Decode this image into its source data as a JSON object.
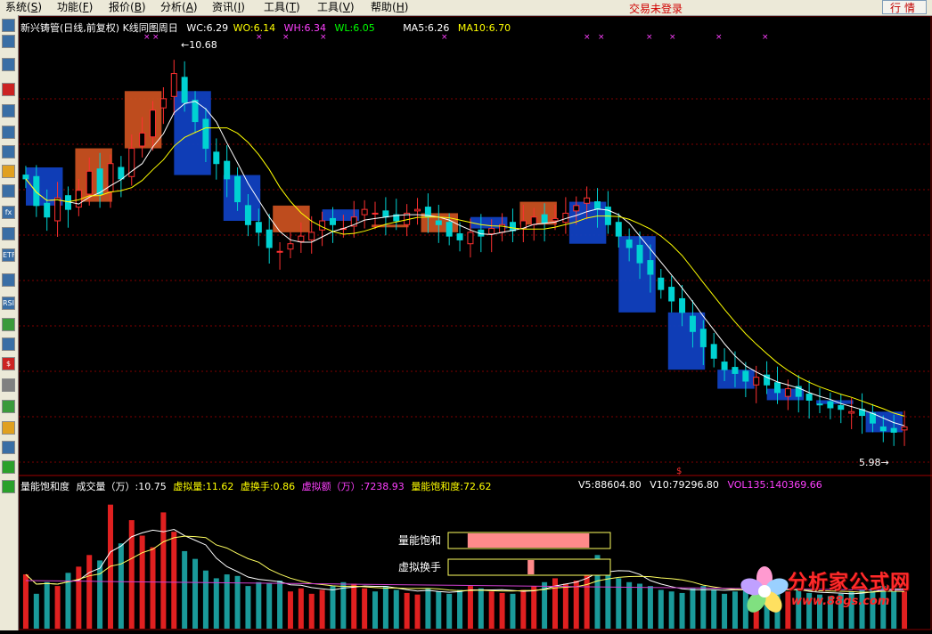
{
  "menu": {
    "items": [
      {
        "label": "系统",
        "key": "S"
      },
      {
        "label": "功能",
        "key": "F"
      },
      {
        "label": "报价",
        "key": "B"
      },
      {
        "label": "分析",
        "key": "A"
      },
      {
        "label": "资讯",
        "key": "I"
      },
      {
        "label": "工具",
        "key": "T"
      },
      {
        "label": "工具",
        "key": "V"
      },
      {
        "label": "帮助",
        "key": "H"
      }
    ],
    "trade_status": "交易未登录",
    "quote_button": "行情"
  },
  "sidebar": {
    "tools": [
      {
        "icon": "list-icon",
        "label": "",
        "color": "#3a6ea5"
      },
      {
        "icon": "split-window-icon",
        "label": "",
        "color": "#3a6ea5"
      },
      {
        "icon": "line-chart-icon",
        "label": "",
        "color": "#3a6ea5"
      },
      {
        "icon": "kline-icon",
        "label": "",
        "color": "#cc2222"
      },
      {
        "icon": "notes-icon",
        "label": "",
        "color": "#3a6ea5"
      },
      {
        "icon": "table-icon",
        "label": "",
        "color": "#3a6ea5"
      },
      {
        "icon": "page-icon",
        "label": "",
        "color": "#3a6ea5"
      },
      {
        "icon": "mail-icon",
        "label": "",
        "color": "#e0a020"
      },
      {
        "icon": "users-icon",
        "label": "",
        "color": "#3a6ea5"
      },
      {
        "icon": "formula-icon",
        "label": "fx",
        "color": "#3a6ea5"
      },
      {
        "icon": "magnifier-icon",
        "label": "",
        "color": "#3a6ea5"
      },
      {
        "icon": "etf-icon",
        "label": "ETF",
        "color": "#3a6ea5"
      },
      {
        "icon": "wave-icon",
        "label": "",
        "color": "#3a6ea5"
      },
      {
        "icon": "rsi-icon",
        "label": "RSI",
        "color": "#3a6ea5"
      },
      {
        "icon": "refresh-icon",
        "label": "",
        "color": "#3a9a3a"
      },
      {
        "icon": "grid-icon",
        "label": "",
        "color": "#3a6ea5"
      },
      {
        "icon": "dollar-icon",
        "label": "$",
        "color": "#cc2222"
      },
      {
        "icon": "wrench-icon",
        "label": "",
        "color": "#808080"
      },
      {
        "icon": "export-icon",
        "label": "",
        "color": "#3a9a3a"
      },
      {
        "icon": "pencil-icon",
        "label": "",
        "color": "#e0a020"
      },
      {
        "icon": "move-icon",
        "label": "",
        "color": "#3a6ea5"
      },
      {
        "icon": "arrow-up-icon",
        "label": "",
        "color": "#2aa02a"
      },
      {
        "icon": "arrow-down-icon",
        "label": "",
        "color": "#2aa02a"
      }
    ]
  },
  "kline_header": {
    "stock": "新兴铸管(日线,前复权)",
    "mode": "K线同图周日",
    "wc": "WC:6.29",
    "wo": "WO:6.14",
    "wh": "WH:6.34",
    "wl": "WL:6.05",
    "ma5": "MA5:6.26",
    "ma10": "MA10:6.70",
    "high_label": "10.68",
    "low_label": "5.98",
    "marker": "$"
  },
  "indicator_header": {
    "name": "量能饱和度",
    "volume": "成交量（万）:10.75",
    "virtual_vol": "虚拟量:11.62",
    "virtual_turnover": "虚换手:0.86",
    "virtual_amount": "虚拟额（万）:7238.93",
    "saturation": "量能饱和度:72.62",
    "v5": "V5:88604.80",
    "v10": "V10:79296.80",
    "vol135": "VOL135:140369.66"
  },
  "gauges": {
    "saturation": {
      "label": "量能饱和",
      "fill_start": 0.12,
      "fill_end": 0.87
    },
    "turnover": {
      "label": "虚拟换手",
      "fill_start": 0.49,
      "fill_end": 0.53
    }
  },
  "watermark": {
    "title": "分析家公式网",
    "url": "www.88gs.com"
  },
  "colors": {
    "up": "#ff3030",
    "down": "#00d2d2",
    "ma5": "#ffffff",
    "ma10": "#ffff00",
    "week_up": "#c85020",
    "week_down": "#1040c0",
    "grid": "#800000",
    "vol_up": "#e02020",
    "vol_down": "#1a9a9a",
    "vol135": "#d040d0",
    "wc": "#ffffff",
    "wo": "#ffff00",
    "wh": "#ff40ff",
    "wl": "#00ff00",
    "label_yellow": "#ffff00",
    "label_white": "#ffffff",
    "label_magenta": "#ff40ff"
  },
  "chart_data": {
    "type": "candlestick",
    "daily_close": [
      9.3,
      8.95,
      8.8,
      9.05,
      8.9,
      9.15,
      9.4,
      9.1,
      9.5,
      9.3,
      9.7,
      9.9,
      10.2,
      10.35,
      10.68,
      10.3,
      10.05,
      9.7,
      9.5,
      9.3,
      9.0,
      8.7,
      8.6,
      8.4,
      8.35,
      8.45,
      8.55,
      8.6,
      8.75,
      8.7,
      8.65,
      8.8,
      8.9,
      8.85,
      8.8,
      8.75,
      8.85,
      8.9,
      8.8,
      8.7,
      8.55,
      8.5,
      8.6,
      8.55,
      8.65,
      8.7,
      8.62,
      8.75,
      8.8,
      8.72,
      8.78,
      8.85,
      8.95,
      9.05,
      8.9,
      8.7,
      8.55,
      8.4,
      8.2,
      8.05,
      7.85,
      7.7,
      7.55,
      7.3,
      7.1,
      6.95,
      6.8,
      6.75,
      6.65,
      6.7,
      6.6,
      6.5,
      6.55,
      6.45,
      6.4,
      6.35,
      6.3,
      6.28,
      6.25,
      6.2,
      6.1,
      6.0,
      5.98,
      6.05
    ],
    "weekly_boxes": [
      {
        "open": 9.45,
        "close": 8.95
      },
      {
        "open": 9.0,
        "close": 9.7
      },
      {
        "open": 9.7,
        "close": 10.45
      },
      {
        "open": 10.45,
        "close": 9.35
      },
      {
        "open": 9.35,
        "close": 8.75
      },
      {
        "open": 8.6,
        "close": 8.95
      },
      {
        "open": 8.9,
        "close": 8.75
      },
      {
        "open": 8.7,
        "close": 8.7
      },
      {
        "open": 8.6,
        "close": 8.85
      },
      {
        "open": 8.8,
        "close": 8.65
      },
      {
        "open": 8.7,
        "close": 9.0
      },
      {
        "open": 9.0,
        "close": 8.45
      },
      {
        "open": 8.55,
        "close": 7.55
      },
      {
        "open": 7.55,
        "close": 6.8
      },
      {
        "open": 6.8,
        "close": 6.55
      },
      {
        "open": 6.55,
        "close": 6.4
      },
      {
        "open": 6.4,
        "close": 6.35
      },
      {
        "open": 6.25,
        "close": 5.98
      }
    ],
    "volume": [
      70,
      45,
      60,
      55,
      72,
      80,
      95,
      88,
      160,
      110,
      140,
      120,
      105,
      150,
      125,
      100,
      90,
      75,
      65,
      70,
      68,
      55,
      60,
      58,
      62,
      48,
      52,
      45,
      50,
      55,
      60,
      58,
      52,
      48,
      55,
      50,
      46,
      44,
      52,
      48,
      45,
      50,
      55,
      52,
      48,
      46,
      45,
      50,
      55,
      60,
      65,
      58,
      62,
      80,
      95,
      72,
      65,
      60,
      58,
      55,
      50,
      48,
      46,
      52,
      55,
      50,
      45,
      48,
      52,
      58,
      50,
      45,
      48,
      52,
      46,
      44,
      42,
      45,
      48,
      50,
      52,
      55,
      50,
      48
    ],
    "ylim": [
      5.6,
      11.2
    ],
    "grid": true
  }
}
